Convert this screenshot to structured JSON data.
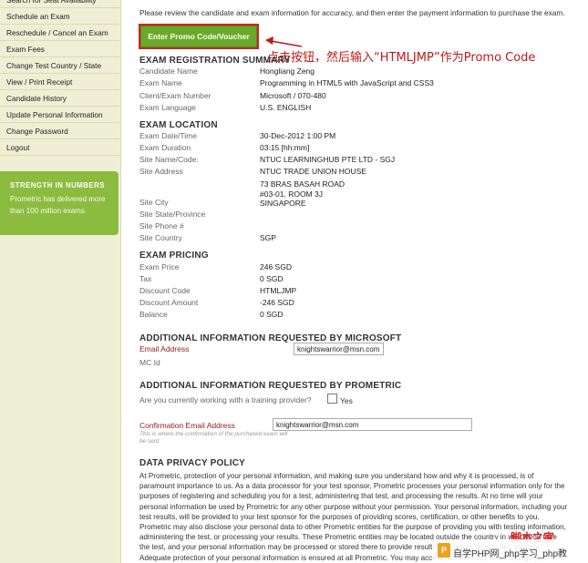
{
  "sidebar": {
    "items": [
      {
        "label": "Search for Seat Availability"
      },
      {
        "label": "Schedule an Exam"
      },
      {
        "label": "Reschedule / Cancel an Exam"
      },
      {
        "label": "Exam Fees"
      },
      {
        "label": "Change Test Country / State"
      },
      {
        "label": "View / Print Receipt"
      },
      {
        "label": "Candidate History"
      },
      {
        "label": "Update Personal Information"
      },
      {
        "label": "Change Password"
      },
      {
        "label": "Logout"
      }
    ],
    "promo": {
      "title": "STRENGTH IN NUMBERS",
      "text": "Prometric has delivered more than 100 million exams."
    }
  },
  "main": {
    "intro": "Please review the candidate and exam information for accuracy, and then enter the payment information to purchase the exam.",
    "promo_button": "Enter Promo Code/Voucher",
    "annotation": "点击按钮，然后输入“HTMLJMP”作为Promo Code",
    "registration": {
      "heading": "EXAM REGISTRATION SUMMARY",
      "rows": [
        {
          "label": "Candidate Name",
          "value": "Hongliang Zeng"
        },
        {
          "label": "Exam Name",
          "value": "Programming in HTML5 with JavaScript and CSS3"
        },
        {
          "label": "Client/Exam Number",
          "value": "Microsoft / 070-480"
        },
        {
          "label": "Exam Language",
          "value": "U.S. ENGLISH"
        }
      ]
    },
    "location": {
      "heading": "EXAM LOCATION",
      "rows": [
        {
          "label": "Exam Date/Time",
          "value": "30-Dec-2012 1:00 PM"
        },
        {
          "label": "Exam Duration",
          "value": "03:15 [hh:mm]"
        },
        {
          "label": "Site Name/Code:",
          "value": "NTUC LEARNINGHUB PTE LTD - SGJ"
        }
      ],
      "address_label": "Site Address",
      "address_lines": [
        "NTUC TRADE UNION HOUSE",
        "",
        "73 BRAS BASAH ROAD",
        "#03-01, ROOM 3J",
        "SINGAPORE"
      ],
      "rows2": [
        {
          "label": "Site City",
          "value": ""
        },
        {
          "label": "Site State/Province",
          "value": ""
        },
        {
          "label": "Site Phone #",
          "value": ""
        },
        {
          "label": "Site Country",
          "value": "SGP"
        }
      ]
    },
    "pricing": {
      "heading": "EXAM PRICING",
      "rows": [
        {
          "label": "Exam Price",
          "value": "246 SGD"
        },
        {
          "label": "Tax",
          "value": "0 SGD"
        },
        {
          "label": "Discount Code",
          "value": "HTMLJMP"
        },
        {
          "label": "Discount Amount",
          "value": "-246 SGD"
        },
        {
          "label": "Balance",
          "value": "0 SGD"
        }
      ]
    },
    "microsoft": {
      "heading": "ADDITIONAL INFORMATION REQUESTED BY MICROSOFT",
      "email_label": "Email Address",
      "email_value": "knightswarrior@msn.com",
      "mcid_label": "MC Id"
    },
    "prometric": {
      "heading": "ADDITIONAL INFORMATION REQUESTED BY PROMETRIC",
      "question": "Are you currently working with a training provider?",
      "yes_label": "Yes"
    },
    "confirmation": {
      "label": "Confirmation Email Address",
      "value": "knightswarrior@msn.com",
      "note": "This is where the confirmation of the purchased exam will be sent."
    },
    "privacy": {
      "heading": "DATA PRIVACY POLICY",
      "text": "At Prometric, protection of your personal information, and making sure you understand how and why it is processed, is of paramount importance to us. As a data processor for your test sponsor, Prometric processes your personal information only for the purposes of registering and scheduling you for a test, administering that test, and processing the results. At no time will your personal information be used by Prometric for any other purpose without your permission. Your personal information, including your test results, will be provided to your test sponsor for the purposes of providing scores, certification, or other benefits to you. Prometric may also disclose your personal data to other Prometric entities for the purpose of providing you with testing information, administering the test, or processing your results. These Prometric entities may be located outside the country in which you take the test, and your personal information may be processed or stored there to provide results and in turn to your test sponsor. Adequate protection of your personal information is ensured at all Prometric. You may access, limit the use of, or change your personal information by contacting your"
    }
  },
  "watermark": {
    "site_cn": "脚本之家",
    "text": "自学PHP网_php学习_php教"
  },
  "colors": {
    "sidebar_bg": "#efefd5",
    "promo_green": "#8cbc3f",
    "button_green": "#69aa2b",
    "annotation_red": "#c01818"
  }
}
